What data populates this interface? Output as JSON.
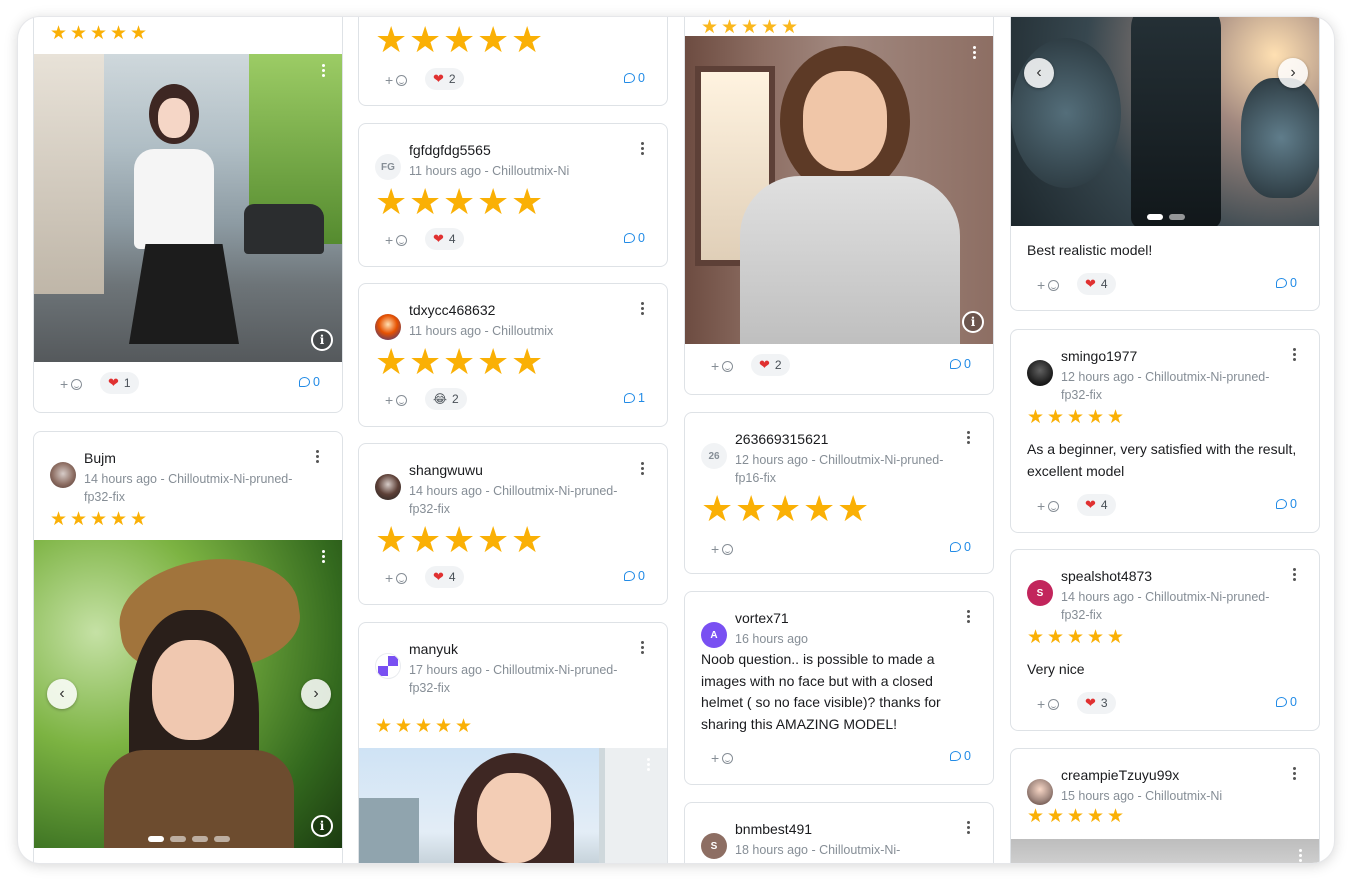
{
  "col1": {
    "card1": {
      "reaction_count": "1",
      "comment_count": "0"
    },
    "card2": {
      "username": "Bujm",
      "meta": "14 hours ago - Chilloutmix-Ni-pruned-fp32-fix"
    }
  },
  "col2": {
    "card1": {
      "reaction_count": "2",
      "comment_count": "0"
    },
    "card2": {
      "username": "fgfdgfdg5565",
      "avatar": "FG",
      "meta": "11 hours ago - Chilloutmix-Ni",
      "reaction_count": "4",
      "comment_count": "0"
    },
    "card3": {
      "username": "tdxycc468632",
      "meta": "11 hours ago - Chilloutmix",
      "reaction_count": "2",
      "comment_count": "1"
    },
    "card4": {
      "username": "shangwuwu",
      "meta": "14 hours ago - Chilloutmix-Ni-pruned-fp32-fix",
      "reaction_count": "4",
      "comment_count": "0"
    },
    "card5": {
      "username": "manyuk",
      "meta": "17 hours ago - Chilloutmix-Ni-pruned-fp32-fix"
    }
  },
  "col3": {
    "card1": {
      "reaction_count": "2",
      "comment_count": "0"
    },
    "card2": {
      "username": "263669315621",
      "avatar": "26",
      "meta": "12 hours ago - Chilloutmix-Ni-pruned-fp16-fix",
      "comment_count": "0"
    },
    "card3": {
      "username": "vortex71",
      "avatar": "A",
      "meta": "16 hours ago",
      "text": "Noob question.. is possible to made a images with no face but with a closed helmet ( so no face visible)? thanks for sharing this AMAZING MODEL!",
      "comment_count": "0"
    },
    "card4": {
      "username": "bnmbest491",
      "avatar": "S",
      "meta": "18 hours ago - Chilloutmix-Ni-"
    }
  },
  "col4": {
    "card1": {
      "text": "Best realistic model!",
      "reaction_count": "4",
      "comment_count": "0"
    },
    "card2": {
      "username": "smingo1977",
      "meta": "12 hours ago - Chilloutmix-Ni-pruned-fp32-fix",
      "text": "As a beginner, very satisfied with the result, excellent model",
      "reaction_count": "4",
      "comment_count": "0"
    },
    "card3": {
      "username": "spealshot4873",
      "avatar": "S",
      "meta": "14 hours ago - Chilloutmix-Ni-pruned-fp32-fix",
      "text": "Very nice",
      "reaction_count": "3",
      "comment_count": "0"
    },
    "card4": {
      "username": "creampieTzuyu99x",
      "meta": "15 hours ago - Chilloutmix-Ni"
    }
  },
  "icons": {
    "star": "★",
    "heart": "❤",
    "laugh": "😂",
    "plus": "+",
    "prev": "‹",
    "next": "›",
    "info": "i"
  },
  "colors": {
    "star": "#fab005",
    "comment": "#228be6",
    "heart": "#e03131",
    "avatar_purple": "#7950f2",
    "avatar_pink": "#c2255c",
    "avatar_brown": "#8d6e63"
  }
}
